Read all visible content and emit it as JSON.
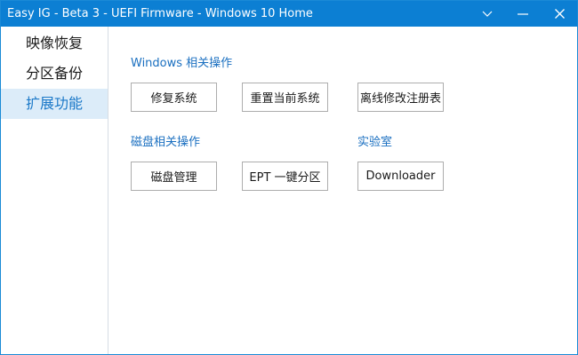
{
  "window": {
    "title": "Easy IG - Beta 3 - UEFI Firmware - Windows 10 Home",
    "controls": [
      {
        "name": "collapse",
        "icon": "chevron-down-icon"
      },
      {
        "name": "minimize",
        "icon": "minimize-icon"
      },
      {
        "name": "close",
        "icon": "close-icon"
      }
    ]
  },
  "sidebar": {
    "items": [
      {
        "label": "映像恢复",
        "active": false
      },
      {
        "label": "分区备份",
        "active": false
      },
      {
        "label": "扩展功能",
        "active": true
      }
    ]
  },
  "main": {
    "sections": {
      "windows": {
        "title": "Windows 相关操作",
        "buttons": [
          "修复系统",
          "重置当前系统",
          "离线修改注册表"
        ]
      },
      "disk": {
        "title": "磁盘相关操作",
        "buttons": [
          "磁盘管理",
          "EPT 一键分区"
        ]
      },
      "lab": {
        "title": "实验室",
        "buttons": [
          "Downloader"
        ]
      }
    }
  },
  "colors": {
    "titlebar": "#0c7fd3",
    "accent": "#1a78c8",
    "sidebar_active_bg": "#dcecf9",
    "section_title": "#1a6fc0",
    "button_border": "#adadad"
  }
}
